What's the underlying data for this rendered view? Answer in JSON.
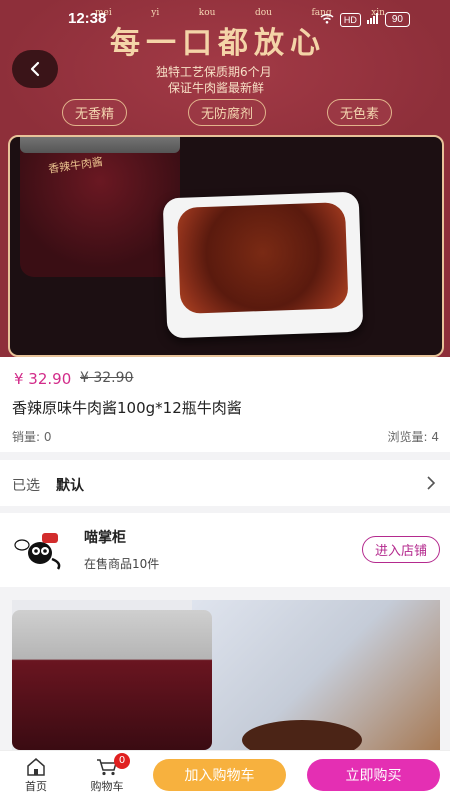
{
  "status_bar": {
    "time": "12:38",
    "network": "HD",
    "battery": "90"
  },
  "banner": {
    "pinyin": [
      "mei",
      "yi",
      "kou",
      "dou",
      "fang",
      "xin"
    ],
    "slogan": "每一口都放心",
    "subtitle_line1": "独特工艺保质期6个月",
    "subtitle_line2": "保证牛肉酱最新鲜",
    "tags": [
      "无香精",
      "无防腐剂",
      "无色素"
    ],
    "jar_label": "香辣牛肉酱"
  },
  "product": {
    "price": "¥ 32.90",
    "original_price": "¥ 32.90",
    "title": "香辣原味牛肉酱100g*12瓶牛肉酱",
    "sales": "销量: 0",
    "views": "浏览量: 4"
  },
  "spec": {
    "label": "已选",
    "value": "默认"
  },
  "shop": {
    "name": "喵掌柜",
    "goods_count": "在售商品10件",
    "enter_label": "进入店铺"
  },
  "bottom_nav": {
    "home_label": "首页",
    "cart_label": "购物车",
    "cart_badge": "0",
    "add_to_cart_label": "加入购物车",
    "buy_now_label": "立即购买"
  },
  "colors": {
    "banner_bg": "#8e2f3a",
    "price": "#d22c8a",
    "add_to_cart": "#f7b13e",
    "buy_now": "#e42fb3"
  }
}
